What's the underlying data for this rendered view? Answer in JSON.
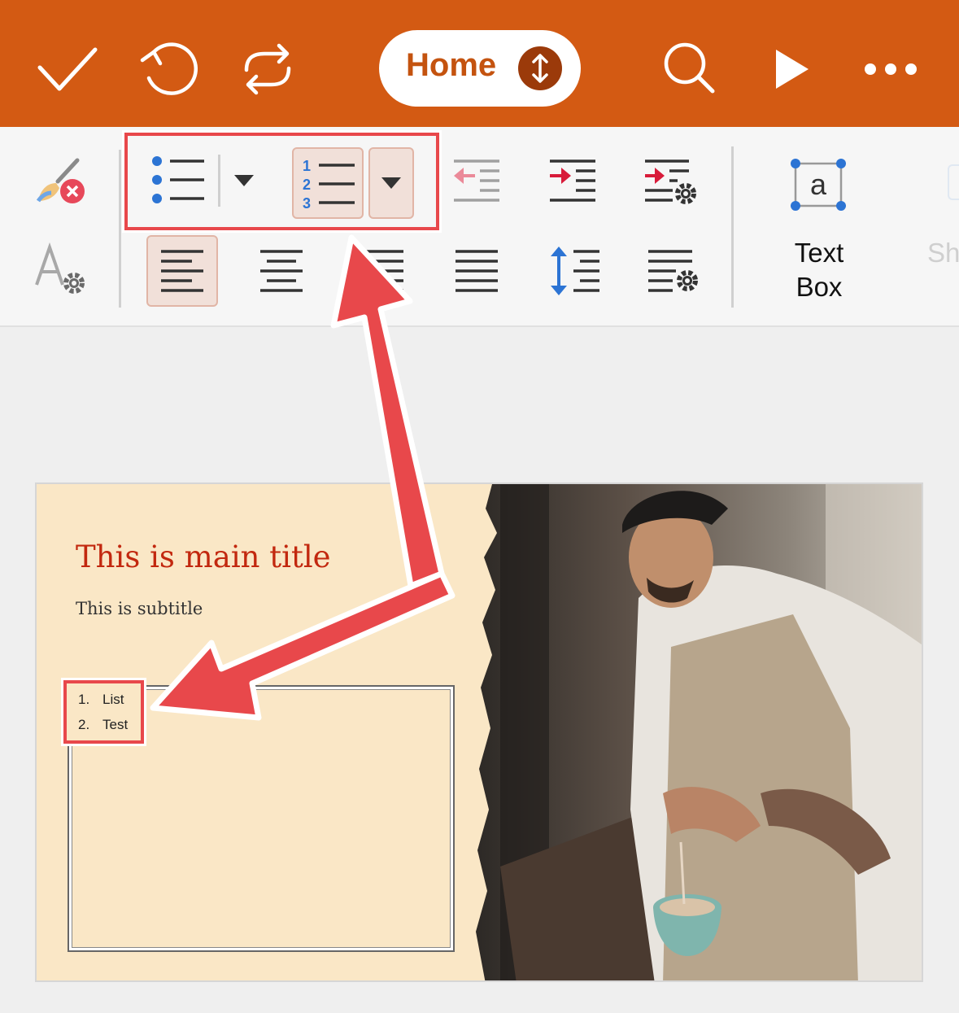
{
  "toolbar": {
    "home_label": "Home",
    "accent_color": "#d35a13"
  },
  "ribbon": {
    "textbox_label_line1": "Text",
    "textbox_label_line2": "Box",
    "textbox_icon_letter": "a",
    "shape_label_partial": "Sh",
    "numbered_list_digits": [
      "1",
      "2",
      "3"
    ]
  },
  "slide": {
    "title": "This is main title",
    "subtitle": "This is subtitle",
    "list": [
      {
        "num": "1.",
        "text": "List"
      },
      {
        "num": "2.",
        "text": "Test"
      }
    ]
  },
  "annotation": {
    "color": "#e8484b"
  }
}
